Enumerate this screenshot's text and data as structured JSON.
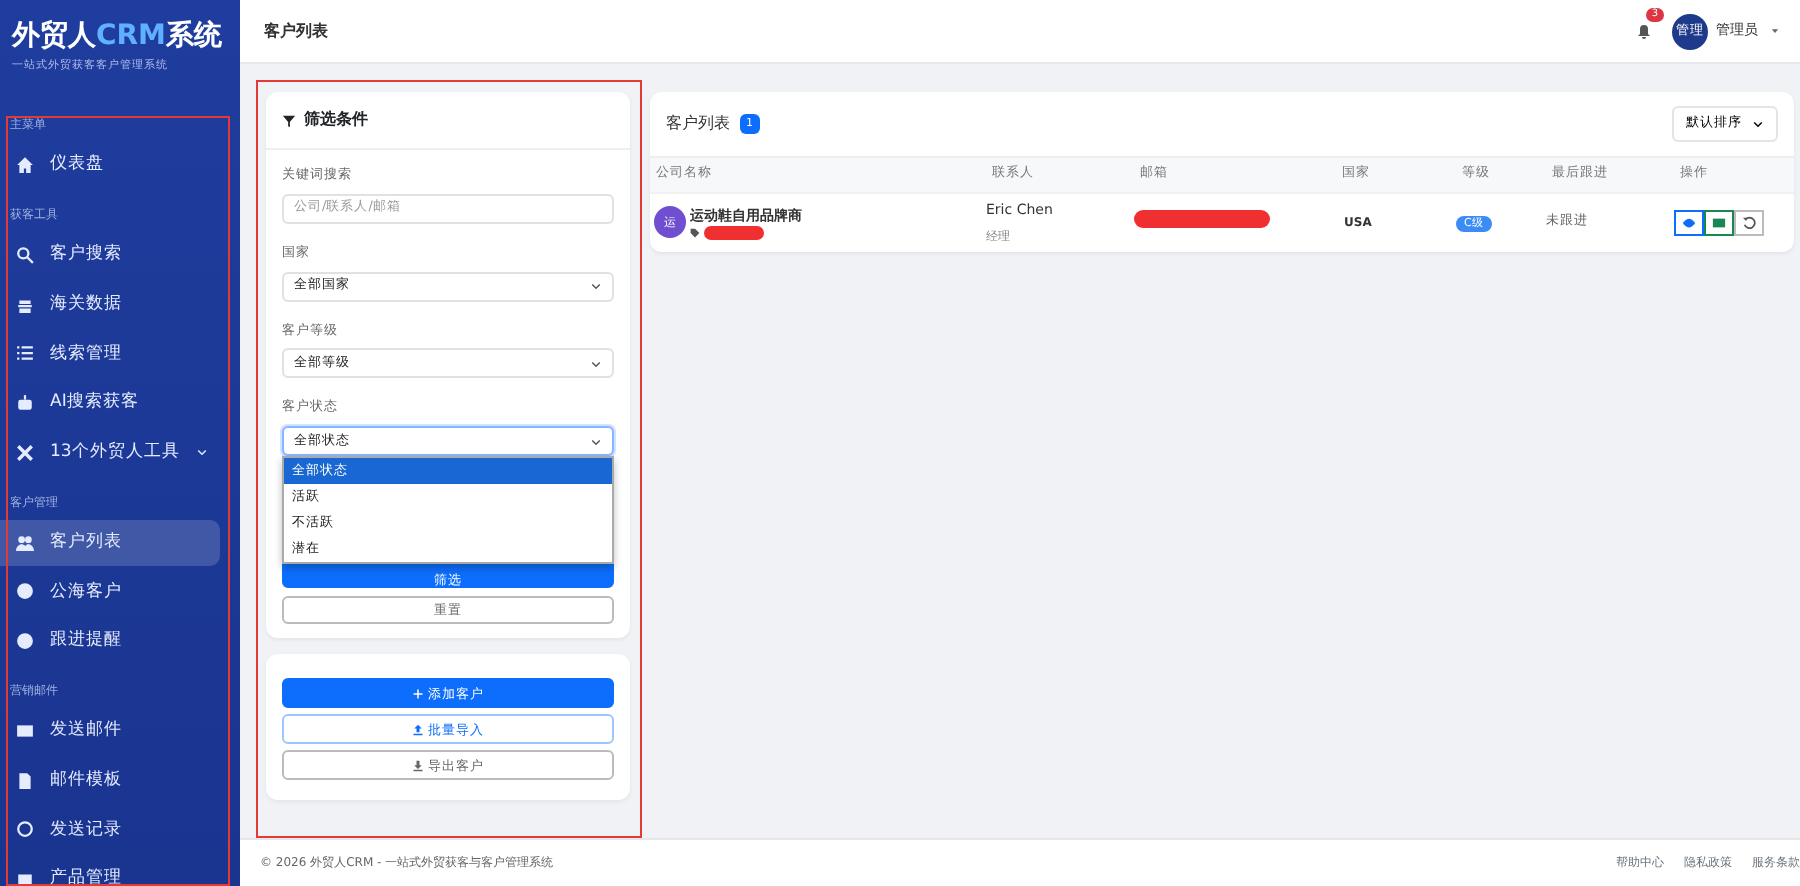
{
  "brand": {
    "name": "外贸人",
    "accent": "CRM",
    "suffix": "系统",
    "tagline": "一站式外贸获客客户管理系统"
  },
  "sidebar": {
    "sections": [
      {
        "heading": "主菜单",
        "items": [
          {
            "label": "仪表盘",
            "selected": false,
            "expandable": false
          }
        ]
      },
      {
        "heading": "获客工具",
        "items": [
          {
            "label": "客户搜索",
            "selected": false,
            "expandable": false
          },
          {
            "label": "海关数据",
            "selected": false,
            "expandable": false
          },
          {
            "label": "线索管理",
            "selected": false,
            "expandable": false
          },
          {
            "label": "AI搜索获客",
            "selected": false,
            "expandable": false
          },
          {
            "label": "13个外贸人工具",
            "selected": false,
            "expandable": true
          }
        ]
      },
      {
        "heading": "客户管理",
        "items": [
          {
            "label": "客户列表",
            "selected": true,
            "expandable": false
          },
          {
            "label": "公海客户",
            "selected": false,
            "expandable": false
          },
          {
            "label": "跟进提醒",
            "selected": false,
            "expandable": false
          }
        ]
      },
      {
        "heading": "营销邮件",
        "items": [
          {
            "label": "发送邮件",
            "selected": false,
            "expandable": false
          },
          {
            "label": "邮件模板",
            "selected": false,
            "expandable": false
          },
          {
            "label": "发送记录",
            "selected": false,
            "expandable": false
          },
          {
            "label": "产品管理",
            "selected": false,
            "expandable": false
          }
        ]
      }
    ]
  },
  "header": {
    "title": "客户列表",
    "notifications": "3",
    "avatar": "管理",
    "user": "管理员"
  },
  "filter": {
    "title": "筛选条件",
    "fields": [
      {
        "kind": "input",
        "label": "关键词搜索",
        "placeholder": "公司/联系人/邮箱"
      },
      {
        "kind": "select",
        "label": "国家",
        "value": "全部国家",
        "open": false
      },
      {
        "kind": "select",
        "label": "客户等级",
        "value": "全部等级",
        "open": false
      },
      {
        "kind": "select",
        "label": "客户状态",
        "value": "全部状态",
        "open": true,
        "options": [
          {
            "label": "全部状态",
            "selected": true
          },
          {
            "label": "活跃",
            "selected": false
          },
          {
            "label": "不活跃",
            "selected": false
          },
          {
            "label": "潜在",
            "selected": false
          }
        ]
      }
    ],
    "buttons": [
      {
        "label": "筛选",
        "kind": "primary"
      },
      {
        "label": "重置",
        "kind": "secondary"
      }
    ]
  },
  "actions": [
    {
      "label": "添加客户",
      "kind": "primary"
    },
    {
      "label": "批量导入",
      "kind": "outline"
    },
    {
      "label": "导出客户",
      "kind": "secondary"
    }
  ],
  "list": {
    "title": "客户列表",
    "count": "1",
    "sort": "默认排序",
    "columns": [
      "公司名称",
      "联系人",
      "邮箱",
      "国家",
      "等级",
      "最后跟进",
      "操作"
    ],
    "rows": [
      {
        "avatar": "运",
        "company": "运动鞋自用品牌商",
        "contact": "Eric Chen",
        "role": "经理",
        "country": "USA",
        "level": "C级",
        "last_follow": "未跟进"
      }
    ]
  },
  "footer": {
    "copyright": "© 2026 外贸人CRM - 一站式外贸获客与客户管理系统",
    "links": [
      "帮助中心",
      "隐私政策",
      "服务条款"
    ]
  }
}
